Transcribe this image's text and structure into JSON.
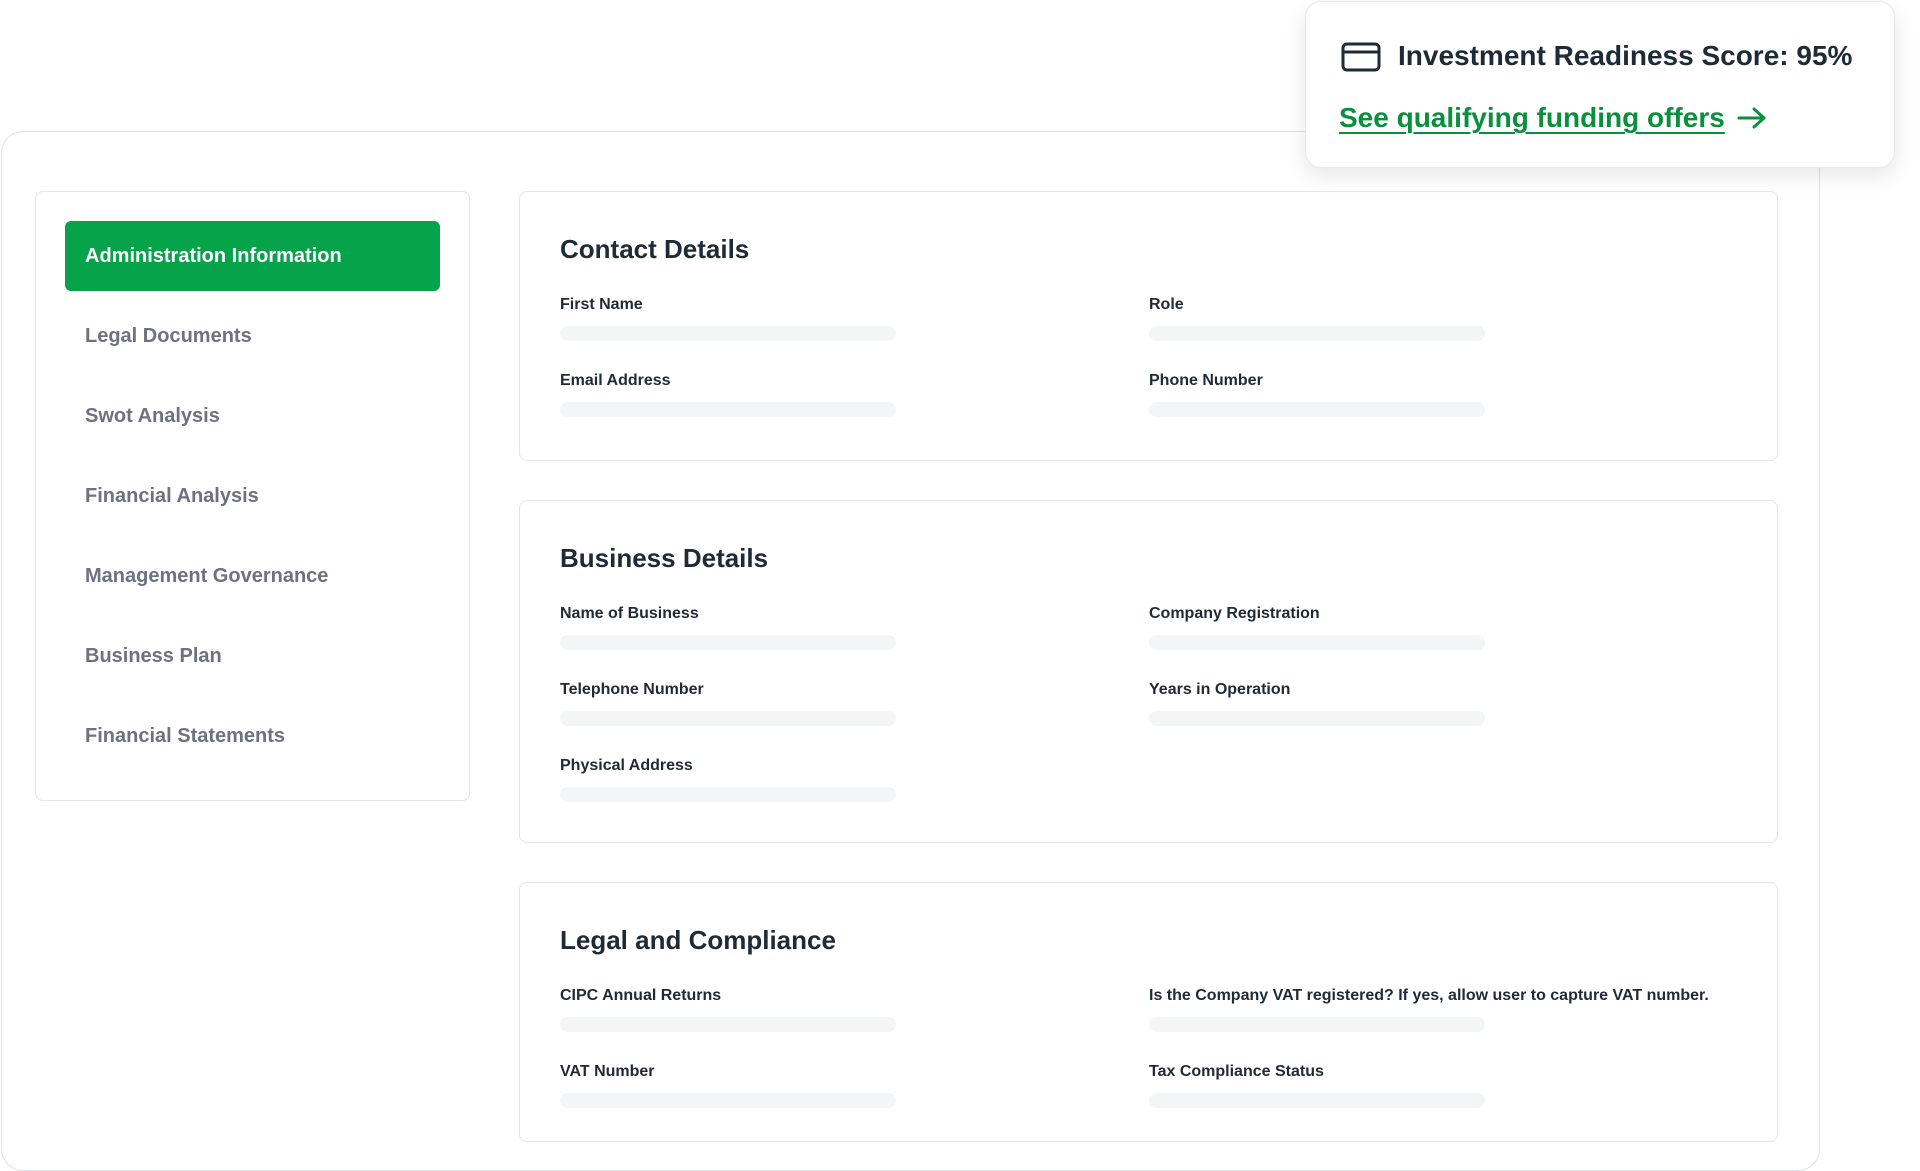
{
  "sidebar": {
    "items": [
      {
        "label": "Administration Information",
        "active": true
      },
      {
        "label": "Legal Documents",
        "active": false
      },
      {
        "label": "Swot Analysis",
        "active": false
      },
      {
        "label": "Financial Analysis",
        "active": false
      },
      {
        "label": "Management Governance",
        "active": false
      },
      {
        "label": "Business Plan",
        "active": false
      },
      {
        "label": "Financial Statements",
        "active": false
      }
    ]
  },
  "contact_details": {
    "title": "Contact Details",
    "fields": {
      "first_name": {
        "label": "First Name",
        "value": ""
      },
      "role": {
        "label": "Role",
        "value": ""
      },
      "email": {
        "label": "Email Address",
        "value": ""
      },
      "phone": {
        "label": "Phone Number",
        "value": ""
      }
    }
  },
  "business_details": {
    "title": "Business Details",
    "fields": {
      "name": {
        "label": "Name of Business",
        "value": ""
      },
      "registration": {
        "label": "Company Registration",
        "value": ""
      },
      "telephone": {
        "label": "Telephone Number",
        "value": ""
      },
      "years": {
        "label": "Years in Operation",
        "value": ""
      },
      "address": {
        "label": "Physical Address",
        "value": ""
      }
    }
  },
  "legal_compliance": {
    "title": "Legal and Compliance",
    "fields": {
      "cipc": {
        "label": "CIPC Annual Returns",
        "value": ""
      },
      "vat_registered": {
        "label": "Is the Company VAT registered? If yes, allow user to capture VAT number.",
        "value": ""
      },
      "vat_number": {
        "label": "VAT Number",
        "value": ""
      },
      "tax_status": {
        "label": "Tax Compliance Status",
        "value": ""
      }
    }
  },
  "readiness": {
    "score_text": "Investment Readiness Score: 95%",
    "link_label": "See qualifying funding offers",
    "icon": "credit-card-icon",
    "link_icon": "arrow-right-icon"
  },
  "colors": {
    "accent": "#06a34a",
    "link": "#0a8f3c",
    "text": "#1f2a37",
    "muted": "#6b7280",
    "input_bg": "#f4f5f7"
  }
}
